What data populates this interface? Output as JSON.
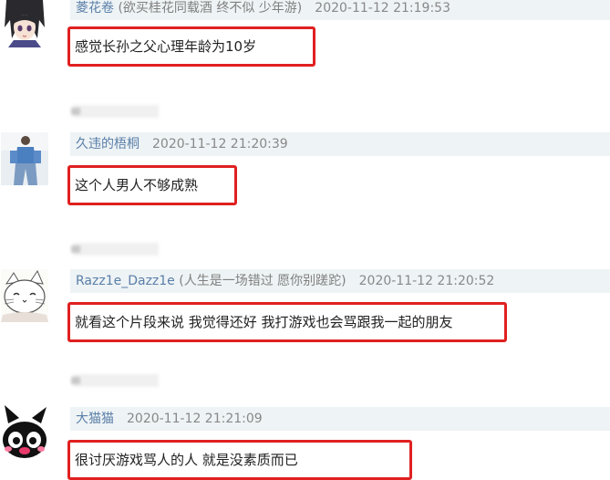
{
  "comments": [
    {
      "username": "菱花卷",
      "signature": " (欲买桂花同载酒 终不似 少年游)",
      "time": "2020-11-12 21:19:53",
      "text": "感觉长孙之父心理年龄为10岁"
    },
    {
      "username": "久违的梧桐",
      "signature": "",
      "time": "2020-11-12 21:20:39",
      "text": "这个人男人不够成熟"
    },
    {
      "username": "Razz1e_Dazz1e",
      "signature": " (人生是一场错过 愿你别蹉跎)",
      "time": "2020-11-12 21:20:52",
      "text": "就看这个片段来说 我觉得还好 我打游戏也会骂跟我一起的朋友"
    },
    {
      "username": "大猫猫",
      "signature": "",
      "time": "2020-11-12 21:21:09",
      "text": "很讨厌游戏骂人的人 就是没素质而已"
    }
  ],
  "colors": {
    "highlight_border": "#e02020",
    "meta_background": "#eef3f5",
    "username": "#5a7fa8"
  },
  "icons": [
    "anime-girl-avatar",
    "person-photo-avatar",
    "cat-drawing-avatar",
    "black-cat-avatar"
  ]
}
